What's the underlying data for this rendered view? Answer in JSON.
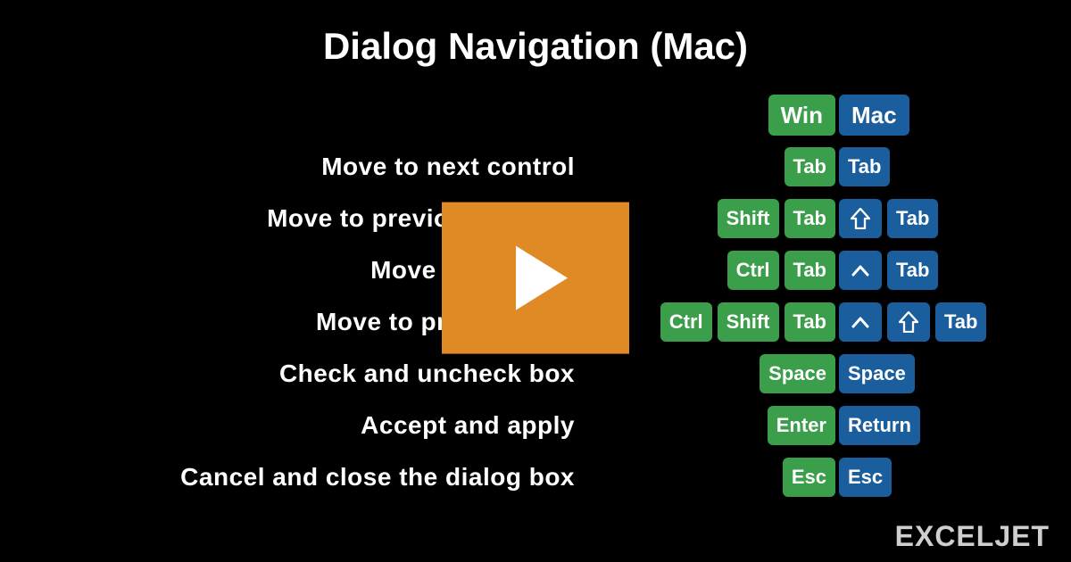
{
  "title": "Dialog Navigation (Mac)",
  "header": {
    "win": "Win",
    "mac": "Mac"
  },
  "keys": {
    "tab": "Tab",
    "shift": "Shift",
    "ctrl": "Ctrl",
    "space": "Space",
    "enter": "Enter",
    "return": "Return",
    "esc": "Esc"
  },
  "icons": {
    "shift_arrow": "shift-up-icon",
    "control_caret": "control-caret-icon"
  },
  "rows": [
    {
      "label": "Move to next control"
    },
    {
      "label": "Move to previous control"
    },
    {
      "label": "Move to next tab"
    },
    {
      "label": "Move to previous tab"
    },
    {
      "label": "Check and uncheck box"
    },
    {
      "label": "Accept and apply"
    },
    {
      "label": "Cancel and close the dialog box"
    }
  ],
  "brand": "EXCELJET",
  "colors": {
    "win": "#3a9e4a",
    "mac": "#1b5e9e",
    "play": "#e08a26"
  }
}
